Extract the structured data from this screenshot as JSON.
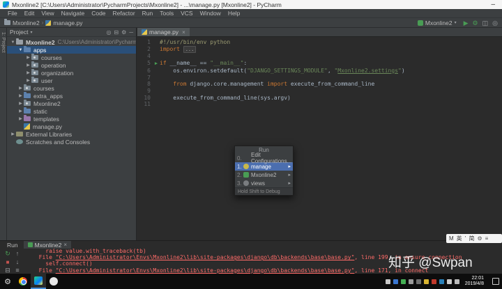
{
  "window": {
    "title": "Mxonline2 [C:\\Users\\Administrator\\PycharmProjects\\Mxonline2] - ...\\manage.py [Mxonline2] - PyCharm",
    "minimize_glyph": "–"
  },
  "menu_bar": {
    "items": [
      "File",
      "Edit",
      "View",
      "Navigate",
      "Code",
      "Refactor",
      "Run",
      "Tools",
      "VCS",
      "Window",
      "Help"
    ]
  },
  "nav_bar": {
    "breadcrumbs": [
      {
        "label": "Mxonline2",
        "icon": "folder"
      },
      {
        "label": "manage.py",
        "icon": "python"
      }
    ],
    "run_config": "Mxonline2"
  },
  "tool_strip": {
    "project_label": "1: Project"
  },
  "project_panel": {
    "header": "Project",
    "tree": [
      {
        "indent": 0,
        "arrow": "down",
        "icon": "project",
        "label": "Mxonline2",
        "path": "C:\\Users\\Administrator\\PycharmProjects\\Mxonl",
        "bold": true
      },
      {
        "indent": 1,
        "arrow": "down",
        "icon": "folder-blue",
        "label": "apps",
        "selected": true
      },
      {
        "indent": 2,
        "arrow": "right",
        "icon": "folder-pkg",
        "label": "courses"
      },
      {
        "indent": 2,
        "arrow": "right",
        "icon": "folder-pkg",
        "label": "operation"
      },
      {
        "indent": 2,
        "arrow": "right",
        "icon": "folder-pkg",
        "label": "organization"
      },
      {
        "indent": 2,
        "arrow": "right",
        "icon": "folder-pkg",
        "label": "user"
      },
      {
        "indent": 1,
        "arrow": "right",
        "icon": "folder-pkg",
        "label": "courses"
      },
      {
        "indent": 1,
        "arrow": "right",
        "icon": "folder-blue",
        "label": "extra_apps"
      },
      {
        "indent": 1,
        "arrow": "right",
        "icon": "folder-pkg",
        "label": "Mxonline2"
      },
      {
        "indent": 1,
        "arrow": "right",
        "icon": "folder-blue",
        "label": "static"
      },
      {
        "indent": 1,
        "arrow": "right",
        "icon": "folder-purple",
        "label": "templates"
      },
      {
        "indent": 1,
        "arrow": "none",
        "icon": "python-file",
        "label": "manage.py"
      },
      {
        "indent": 0,
        "arrow": "right",
        "icon": "libraries",
        "label": "External Libraries"
      },
      {
        "indent": 0,
        "arrow": "none",
        "icon": "scratches",
        "label": "Scratches and Consoles"
      }
    ]
  },
  "editor": {
    "tab": "manage.py",
    "lines": [
      {
        "num": "1",
        "segments": [
          {
            "t": "#!/usr/bin/env python",
            "c": "comment"
          }
        ]
      },
      {
        "num": "2",
        "segments": [
          {
            "t": "import ",
            "c": "kw"
          },
          {
            "t": "...",
            "c": "fold"
          }
        ]
      },
      {
        "num": "4",
        "segments": []
      },
      {
        "num": "5",
        "run": true,
        "segments": [
          {
            "t": "if ",
            "c": "kw"
          },
          {
            "t": "__name__ == ",
            "c": "plain"
          },
          {
            "t": "\"__main__\"",
            "c": "str"
          },
          {
            "t": ":",
            "c": "plain"
          }
        ]
      },
      {
        "num": "6",
        "segments": [
          {
            "t": "    os.environ.setdefault(",
            "c": "plain"
          },
          {
            "t": "\"DJANGO_SETTINGS_MODULE\"",
            "c": "str"
          },
          {
            "t": ", ",
            "c": "plain"
          },
          {
            "t": "\"",
            "c": "str"
          },
          {
            "t": "Mxonline2.settings",
            "c": "strlink"
          },
          {
            "t": "\"",
            "c": "str"
          },
          {
            "t": ")",
            "c": "plain"
          }
        ]
      },
      {
        "num": "7",
        "segments": []
      },
      {
        "num": "8",
        "segments": [
          {
            "t": "    ",
            "c": "plain"
          },
          {
            "t": "from ",
            "c": "kw"
          },
          {
            "t": "django.core.management ",
            "c": "plain"
          },
          {
            "t": "import ",
            "c": "kw"
          },
          {
            "t": "execute_from_command_line",
            "c": "plain"
          }
        ]
      },
      {
        "num": "9",
        "segments": []
      },
      {
        "num": "10",
        "segments": [
          {
            "t": "    execute_from_command_line(sys.argv)",
            "c": "plain"
          }
        ]
      },
      {
        "num": "11",
        "segments": []
      }
    ]
  },
  "run_popup": {
    "title": "Run",
    "items": [
      {
        "num": "0.",
        "icon": "edit",
        "label": "Edit Configurations...",
        "arrow": false,
        "selected": false
      },
      {
        "num": "1.",
        "icon": "python",
        "label": "manage",
        "arrow": true,
        "selected": true
      },
      {
        "num": "2.",
        "icon": "django",
        "label": "Mxonline2",
        "arrow": true,
        "selected": false
      },
      {
        "num": "3.",
        "icon": "gear",
        "label": "views",
        "arrow": true,
        "selected": false
      }
    ],
    "footer": "Hold Shift to Debug"
  },
  "console": {
    "tool_window_label": "Run",
    "tab": "Mxonline2",
    "lines": [
      {
        "segments": [
          {
            "t": "    raise value.with_traceback(tb)",
            "c": "err"
          }
        ]
      },
      {
        "segments": [
          {
            "t": "  File ",
            "c": "err"
          },
          {
            "t": "\"C:\\Users\\Administrator\\Envs\\Mxonline2\\lib\\site-packages\\django\\db\\backends\\base\\base.py\"",
            "c": "link"
          },
          {
            "t": ", line 199, in ensure_connection",
            "c": "err"
          }
        ]
      },
      {
        "segments": [
          {
            "t": "    self.connect()",
            "c": "err"
          }
        ]
      },
      {
        "segments": [
          {
            "t": "  File ",
            "c": "err"
          },
          {
            "t": "\"C:\\Users\\Administrator\\Envs\\Mxonline2\\lib\\site-packages\\django\\db\\backends\\base\\base.py\"",
            "c": "link"
          },
          {
            "t": ", line 171, in connect",
            "c": "err"
          }
        ]
      }
    ]
  },
  "watermark": "知乎 @Swpan",
  "ime_bar": {
    "items": [
      "M",
      "英",
      "’",
      "简"
    ]
  },
  "taskbar": {
    "clock_time": "22:01",
    "clock_date": "2019/4/8",
    "tray_icons": [
      "doc-icon",
      "chat-blue-icon",
      "shield-green-icon",
      "gear-icon",
      "cube-icon",
      "alert-yellow-icon",
      "badge-red-icon",
      "flag-blue-icon",
      "monitor-icon",
      "volume-icon"
    ]
  },
  "colors": {
    "selection_blue": "#4b6eaf",
    "tree_selection": "#2a4f79",
    "error_red": "#ff6b68",
    "run_green": "#499c54",
    "keyword_orange": "#cc7832",
    "string_green": "#6a8759",
    "panel_bg": "#3c3f41",
    "editor_bg": "#2b2b2b"
  }
}
